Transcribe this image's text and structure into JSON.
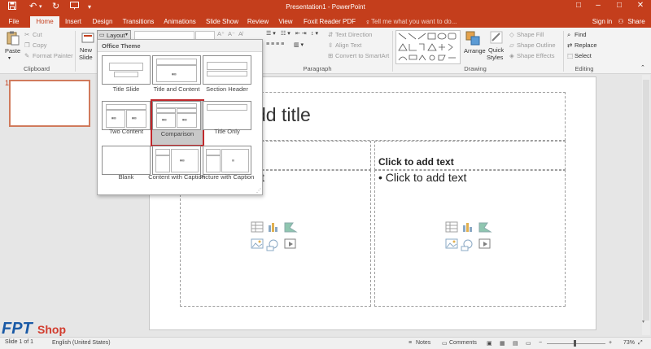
{
  "window": {
    "title": "Presentation1 - PowerPoint",
    "controls": [
      "□",
      "–",
      "□",
      "✕"
    ]
  },
  "tabs": [
    {
      "label": "File"
    },
    {
      "label": "Home"
    },
    {
      "label": "Insert"
    },
    {
      "label": "Design"
    },
    {
      "label": "Transitions"
    },
    {
      "label": "Animations"
    },
    {
      "label": "Slide Show"
    },
    {
      "label": "Review"
    },
    {
      "label": "View"
    },
    {
      "label": "Foxit Reader PDF"
    }
  ],
  "tell_me": "Tell me what you want to do...",
  "account": {
    "sign_in": "Sign in",
    "share": "Share"
  },
  "ribbon": {
    "clipboard": {
      "paste": "Paste",
      "cut": "Cut",
      "copy": "Copy",
      "format_painter": "Format Painter",
      "label": "Clipboard"
    },
    "slides": {
      "new_slide_line1": "New",
      "new_slide_line2": "Slide",
      "layout": "Layout"
    },
    "paragraph": {
      "text_direction": "Text Direction",
      "align_text": "Align Text",
      "convert_smartart": "Convert to SmartArt",
      "label": "Paragraph"
    },
    "drawing": {
      "arrange": "Arrange",
      "quick_styles_line1": "Quick",
      "quick_styles_line2": "Styles",
      "shape_fill": "Shape Fill",
      "shape_outline": "Shape Outline",
      "shape_effects": "Shape Effects",
      "label": "Drawing"
    },
    "editing": {
      "find": "Find",
      "replace": "Replace",
      "select": "Select",
      "label": "Editing"
    }
  },
  "gallery": {
    "header": "Office Theme",
    "layouts": [
      {
        "label": "Title Slide"
      },
      {
        "label": "Title and Content"
      },
      {
        "label": "Section Header"
      },
      {
        "label": "Two Content"
      },
      {
        "label": "Comparison"
      },
      {
        "label": "Title Only"
      },
      {
        "label": "Blank"
      },
      {
        "label": "Content with Caption"
      },
      {
        "label": "Picture with Caption"
      }
    ]
  },
  "slide": {
    "number": "1",
    "title_fragment": "dd title",
    "right_heading": "Click to add text",
    "right_bullet": "• Click to add text",
    "left_bullet_fragment": "xt"
  },
  "statusbar": {
    "slide_info": "Slide 1 of 1",
    "language": "English (United States)",
    "notes": "Notes",
    "comments": "Comments",
    "zoom": "73%"
  },
  "watermark": {
    "part1": "FPT",
    "part2": "Shop",
    ".com": ".com.vn"
  },
  "colors": {
    "accent": "#c43e1c",
    "selection": "#c0282c"
  }
}
